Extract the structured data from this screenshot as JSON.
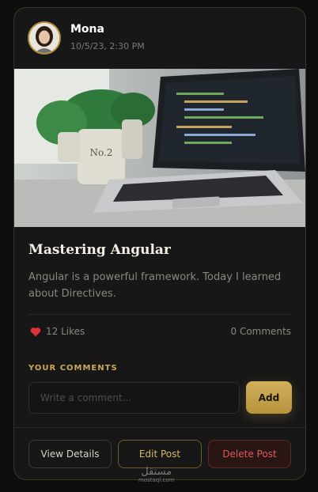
{
  "post": {
    "author": "Mona",
    "timestamp": "10/5/23, 2:30 PM",
    "title": "Mastering Angular",
    "description": "Angular is a powerful framework. Today I learned about Directives.",
    "likes_label": "12 Likes",
    "comments_label": "0 Comments"
  },
  "comments_section": {
    "label": "YOUR COMMENTS",
    "input_placeholder": "Write a comment...",
    "add_label": "Add"
  },
  "actions": {
    "view_label": "View Details",
    "edit_label": "Edit Post",
    "delete_label": "Delete Post"
  },
  "watermark": {
    "main": "مستقل",
    "sub": "mostaql.com"
  },
  "colors": {
    "accent_gold": "#c9a85a",
    "like_heart": "#e0303a",
    "delete_red": "#e05a5a"
  }
}
